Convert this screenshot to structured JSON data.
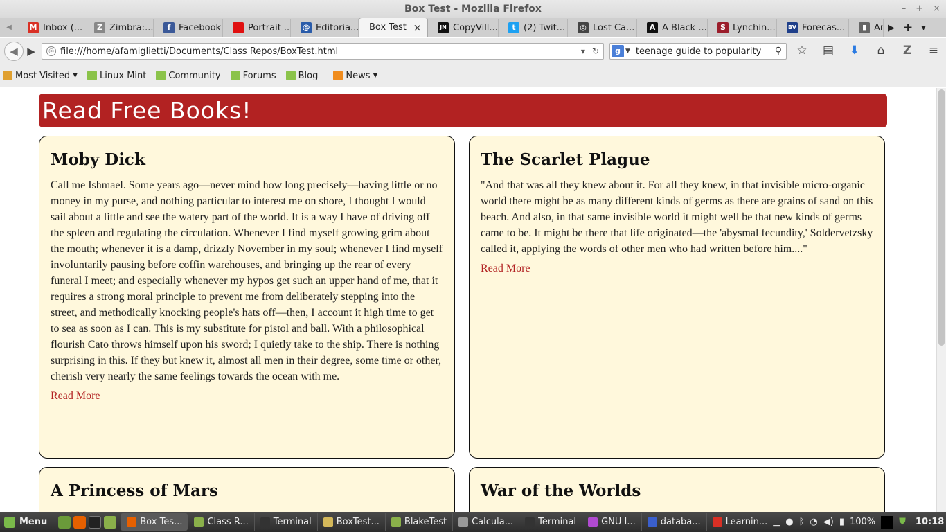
{
  "window": {
    "title": "Box Test - Mozilla Firefox",
    "controls": [
      "–",
      "+",
      "×"
    ]
  },
  "tabs": [
    {
      "label": "Inbox (...",
      "icon": "gmail-icon",
      "color": "#d93025",
      "glyph": "M"
    },
    {
      "label": "Zimbra:...",
      "icon": "zimbra-icon",
      "color": "#888888",
      "glyph": "Z"
    },
    {
      "label": "Facebook",
      "icon": "facebook-icon",
      "color": "#3b5998",
      "glyph": "f"
    },
    {
      "label": "Portrait ...",
      "icon": "portrait-icon",
      "color": "#e01010",
      "glyph": ""
    },
    {
      "label": "Editoria...",
      "icon": "editorial-icon",
      "color": "#2a5caa",
      "glyph": "@"
    },
    {
      "label": "Box Test",
      "icon": "",
      "color": "",
      "glyph": "",
      "active": true
    },
    {
      "label": "CopyVill...",
      "icon": "copyvillage-icon",
      "color": "#111111",
      "glyph": "JN"
    },
    {
      "label": "(2) Twit...",
      "icon": "twitter-icon",
      "color": "#1da1f2",
      "glyph": "t"
    },
    {
      "label": "Lost Ca...",
      "icon": "lost-icon",
      "color": "#444444",
      "glyph": "◎"
    },
    {
      "label": "A Black ...",
      "icon": "black-icon",
      "color": "#111111",
      "glyph": "A"
    },
    {
      "label": "Lynchin...",
      "icon": "slate-icon",
      "color": "#9b1d2b",
      "glyph": "S"
    },
    {
      "label": "Forecas...",
      "icon": "bv-icon",
      "color": "#1f3f8a",
      "glyph": "BV"
    },
    {
      "label": "An",
      "icon": "an-icon",
      "color": "#666666",
      "glyph": "▮"
    }
  ],
  "tab_controls": {
    "scroll_left": "◀",
    "scroll_right": "▶",
    "new_tab": "+",
    "list": "▾",
    "close": "×"
  },
  "nav": {
    "url": "file:///home/afamiglietti/Documents/Class Repos/BoxTest.html",
    "search_value": "teenage guide to popularity",
    "search_engine": "g",
    "icons": [
      "star-icon",
      "bookmarks-list-icon",
      "download-icon",
      "home-icon",
      "zotero-icon",
      "menu-icon"
    ]
  },
  "bookmarks": [
    {
      "label": "Most Visited",
      "dropdown": true,
      "kind": "folder"
    },
    {
      "label": "Linux Mint",
      "kind": "mint"
    },
    {
      "label": "Community",
      "kind": "mint"
    },
    {
      "label": "Forums",
      "kind": "mint"
    },
    {
      "label": "Blog",
      "kind": "mint"
    },
    {
      "label": "News",
      "dropdown": true,
      "kind": "rss"
    }
  ],
  "page": {
    "header": "Read Free Books!",
    "cards": [
      {
        "title": "Moby Dick",
        "text": "Call me Ishmael. Some years ago—never mind how long precisely—having little or no money in my purse, and nothing particular to interest me on shore, I thought I would sail about a little and see the watery part of the world. It is a way I have of driving off the spleen and regulating the circulation. Whenever I find myself growing grim about the mouth; whenever it is a damp, drizzly November in my soul; whenever I find myself involuntarily pausing before coffin warehouses, and bringing up the rear of every funeral I meet; and especially whenever my hypos get such an upper hand of me, that it requires a strong moral principle to prevent me from deliberately stepping into the street, and methodically knocking people's hats off—then, I account it high time to get to sea as soon as I can. This is my substitute for pistol and ball. With a philosophical flourish Cato throws himself upon his sword; I quietly take to the ship. There is nothing surprising in this. If they but knew it, almost all men in their degree, some time or other, cherish very nearly the same feelings towards the ocean with me.",
        "link": "Read More"
      },
      {
        "title": "The Scarlet Plague",
        "text": "\"And that was all they knew about it. For all they knew, in that invisible micro-organic world there might be as many different kinds of germs as there are grains of sand on this beach. And also, in that same invisible world it might well be that new kinds of germs came to be. It might be there that life originated—the 'abysmal fecundity,' Soldervetzsky called it, applying the words of other men who had written before him....\"",
        "link": "Read More"
      },
      {
        "title": "A Princess of Mars",
        "text": "",
        "link": ""
      },
      {
        "title": "War of the Worlds",
        "text": "",
        "link": ""
      }
    ]
  },
  "taskbar": {
    "menu": "Menu",
    "tasks": [
      {
        "label": "Box Tes...",
        "active": true,
        "color": "#e66000"
      },
      {
        "label": "Class R...",
        "color": "#8ab04a"
      },
      {
        "label": "Terminal",
        "color": "#333333"
      },
      {
        "label": "BoxTest...",
        "color": "#d4b85a"
      },
      {
        "label": "BlakeTest",
        "color": "#8ab04a"
      },
      {
        "label": "Calcula...",
        "color": "#999999"
      },
      {
        "label": "Terminal",
        "color": "#333333"
      },
      {
        "label": "GNU I...",
        "color": "#b04ad0"
      },
      {
        "label": "databa...",
        "color": "#3a5fcd"
      },
      {
        "label": "Learnin...",
        "color": "#d93025"
      }
    ],
    "battery": "100%",
    "clock": "10:18"
  }
}
